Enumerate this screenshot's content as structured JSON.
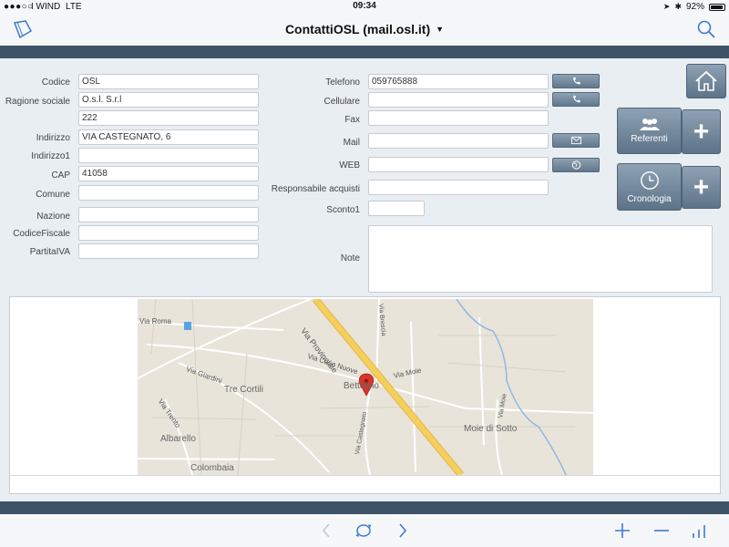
{
  "status": {
    "signal": "●●●○○",
    "carrier": "I WIND",
    "network": "LTE",
    "time": "09:34",
    "battery": "92%",
    "battery_level": 0.92
  },
  "nav": {
    "title": "ContattiOSL (mail.osl.it)",
    "caret": "▼",
    "left_icon": "document-icon",
    "right_icon": "search-icon"
  },
  "form": {
    "left": [
      {
        "label": "Codice",
        "value": "OSL"
      },
      {
        "label": "Ragione sociale",
        "value": "O.s.l. S.r.l"
      },
      {
        "label": "",
        "value": "222"
      },
      {
        "label": "Indirizzo",
        "value": "VIA CASTEGNATO, 6"
      },
      {
        "label": "Indirizzo1",
        "value": ""
      },
      {
        "label": "CAP",
        "value": "41058"
      },
      {
        "label": "Comune",
        "value": ""
      },
      {
        "label": "Nazione",
        "value": ""
      },
      {
        "label": "CodiceFiscale",
        "value": ""
      },
      {
        "label": "PartitaIVA",
        "value": ""
      }
    ],
    "right": {
      "telefono": {
        "label": "Telefono",
        "value": "059765888"
      },
      "cellulare": {
        "label": "Cellulare",
        "value": ""
      },
      "fax": {
        "label": "Fax",
        "value": ""
      },
      "mail": {
        "label": "Mail",
        "value": ""
      },
      "web": {
        "label": "WEB",
        "value": ""
      },
      "responsabile": {
        "label": "Responsabile acquisti",
        "value": ""
      },
      "sconto": {
        "label": "Sconto1",
        "value": ""
      },
      "note": {
        "label": "Note",
        "value": ""
      }
    }
  },
  "actions": {
    "home_icon": "home-icon",
    "referenti": "Referenti",
    "cronologia": "Cronologia",
    "add": "+"
  },
  "map": {
    "labels": [
      "Via Roma",
      "Via Provinciale",
      "Via Brescia",
      "Via Case Nuove",
      "Via Giardini",
      "Tre Cortili",
      "Via Moie",
      "Bettolino",
      "Via Trento",
      "Via Castegnato",
      "Via Moie",
      "Albarello",
      "Moie di Sotto",
      "Colombaia"
    ]
  },
  "colors": {
    "band": "#3e5366",
    "button": "#6e8498",
    "accent": "#3b7bd6",
    "pin": "#d9332b",
    "road_major": "#f5cf5c"
  }
}
